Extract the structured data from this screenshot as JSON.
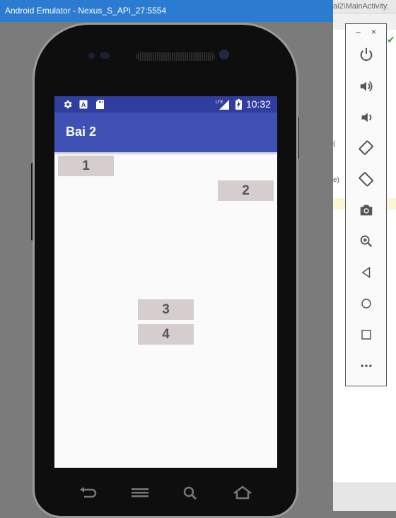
{
  "window": {
    "title": "Android Emulator - Nexus_S_API_27:5554"
  },
  "ide": {
    "tab_text": "ai2\\MainActivity.",
    "code_fragments": [
      "(",
      "e)"
    ]
  },
  "status_bar": {
    "icons": [
      "gear-icon",
      "a-notification-icon",
      "sd-card-icon",
      "lte-signal-icon",
      "battery-charging-icon"
    ],
    "network_label": "LTE",
    "time": "10:32",
    "color": "#303f9f"
  },
  "app_bar": {
    "title": "Bai 2",
    "color": "#3f51b5"
  },
  "buttons": [
    {
      "label": "1"
    },
    {
      "label": "2"
    },
    {
      "label": "3"
    },
    {
      "label": "4"
    }
  ],
  "nav_bar": {
    "icons": [
      "back-icon",
      "menu-icon",
      "search-icon",
      "home-icon"
    ]
  },
  "toolbar": {
    "window_controls": [
      "–",
      "×"
    ],
    "buttons": [
      "power-icon",
      "volume-up-icon",
      "volume-down-icon",
      "rotate-left-icon",
      "rotate-right-icon",
      "camera-icon",
      "zoom-icon",
      "back-icon",
      "home-icon",
      "overview-icon",
      "more-icon"
    ]
  }
}
